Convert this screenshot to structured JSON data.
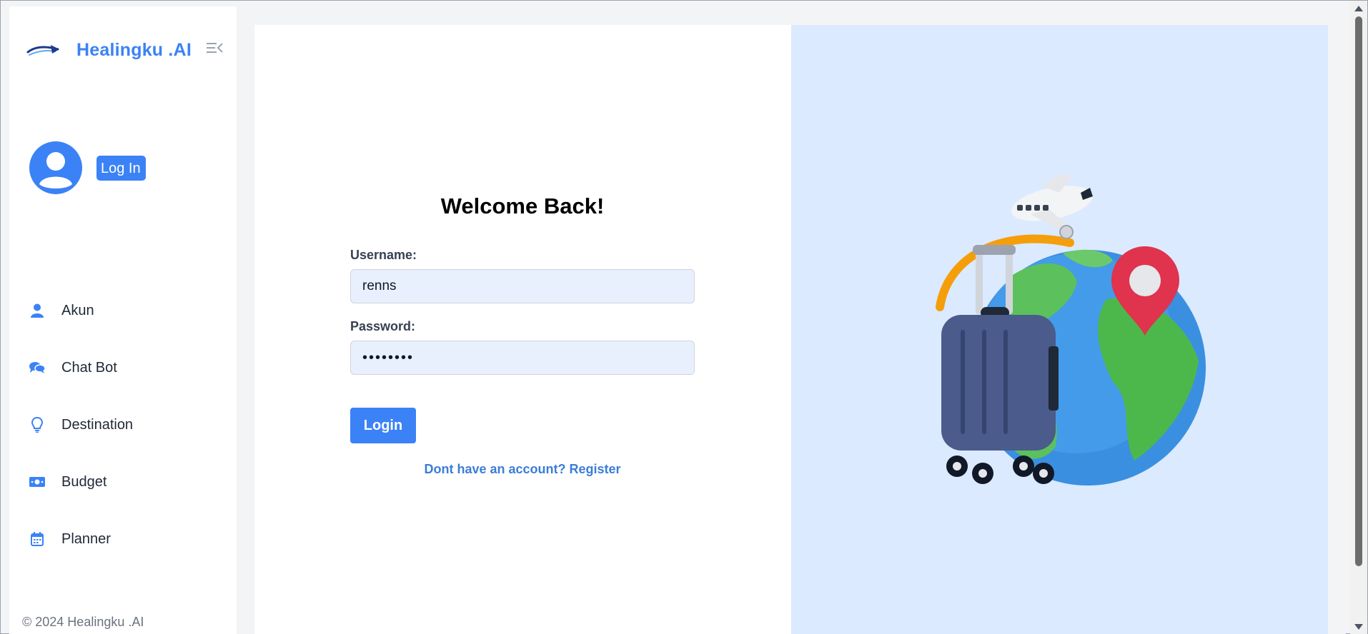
{
  "brand": {
    "name": "Healingku .AI"
  },
  "user": {
    "login_button": "Log In"
  },
  "nav": {
    "items": [
      {
        "label": "Akun",
        "icon": "user-icon"
      },
      {
        "label": "Chat Bot",
        "icon": "chat-icon"
      },
      {
        "label": "Destination",
        "icon": "lightbulb-icon"
      },
      {
        "label": "Budget",
        "icon": "money-icon"
      },
      {
        "label": "Planner",
        "icon": "calendar-icon"
      }
    ]
  },
  "footer": {
    "copyright": "© 2024 Healingku .AI"
  },
  "login": {
    "title": "Welcome Back!",
    "username_label": "Username:",
    "username_value": "renns",
    "password_label": "Password:",
    "password_value": "••••••••",
    "submit_label": "Login",
    "register_link": "Dont have an account? Register"
  },
  "colors": {
    "accent": "#3b82f6",
    "art_background": "#dbeafe",
    "input_background": "#e8f0fe"
  }
}
